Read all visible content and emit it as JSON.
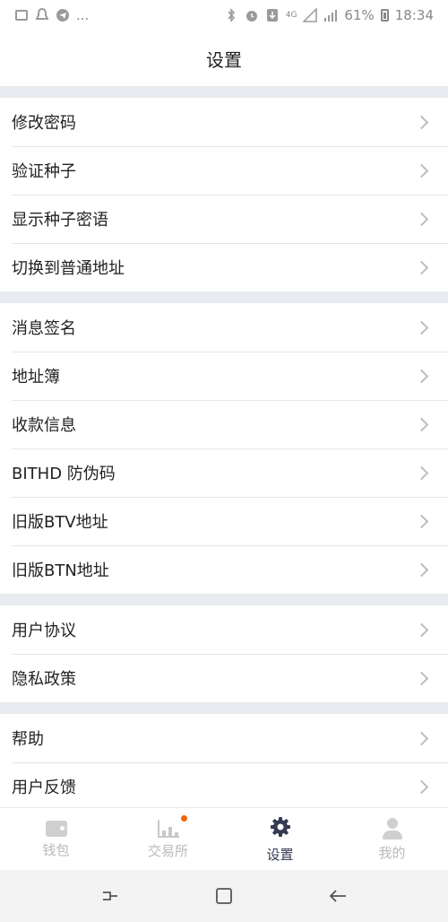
{
  "status_bar": {
    "more": "...",
    "network": "4G",
    "battery": "61%",
    "time": "18:34"
  },
  "header": {
    "title": "设置"
  },
  "groups": [
    {
      "items": [
        {
          "label": "修改密码"
        },
        {
          "label": "验证种子"
        },
        {
          "label": "显示种子密语"
        },
        {
          "label": "切换到普通地址"
        }
      ]
    },
    {
      "items": [
        {
          "label": "消息签名"
        },
        {
          "label": "地址簿"
        },
        {
          "label": "收款信息"
        },
        {
          "label": "BITHD 防伪码"
        },
        {
          "label": "旧版BTV地址"
        },
        {
          "label": "旧版BTN地址"
        }
      ]
    },
    {
      "items": [
        {
          "label": "用户协议"
        },
        {
          "label": "隐私政策"
        }
      ]
    },
    {
      "items": [
        {
          "label": "帮助"
        },
        {
          "label": "用户反馈"
        }
      ]
    }
  ],
  "tabbar": {
    "tabs": [
      {
        "label": "钱包",
        "icon": "wallet-icon"
      },
      {
        "label": "交易所",
        "icon": "chart-icon"
      },
      {
        "label": "设置",
        "icon": "gear-icon"
      },
      {
        "label": "我的",
        "icon": "user-icon"
      }
    ],
    "active_color": "#333a52",
    "inactive_color": "#b9b9b9",
    "badge_color": "#f0650f"
  }
}
